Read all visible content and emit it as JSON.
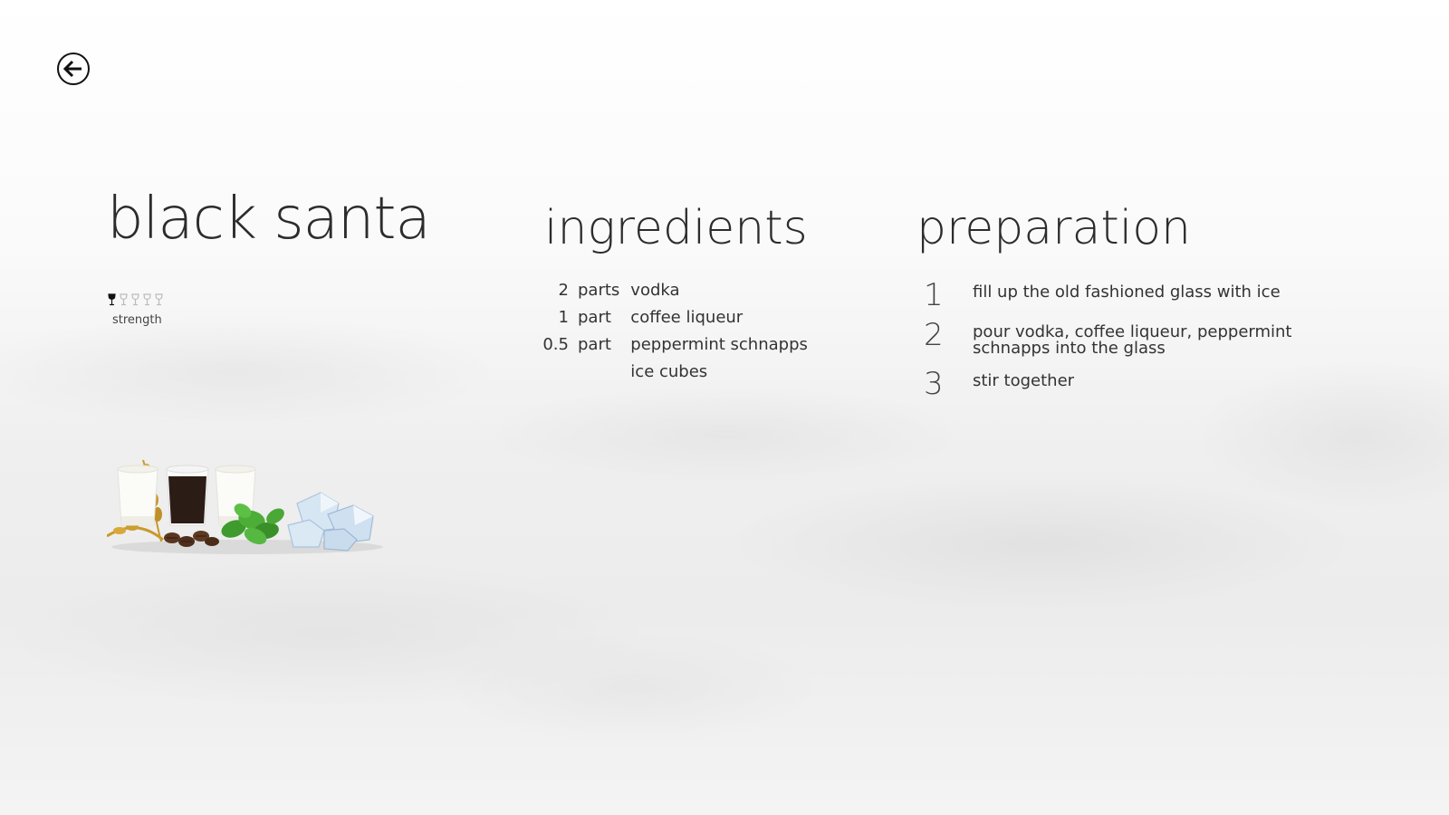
{
  "header": {
    "back_icon": "arrow-left-circle-icon"
  },
  "drink": {
    "name": "black santa",
    "strength": {
      "label": "strength",
      "level": 1,
      "max": 5
    },
    "image_alt": "ingredient cups with wheat, coffee beans, mint and ice"
  },
  "ingredients": {
    "heading": "ingredients",
    "items": [
      {
        "amount": "2",
        "unit": "parts",
        "name": "vodka"
      },
      {
        "amount": "1",
        "unit": "part",
        "name": "coffee liqueur"
      },
      {
        "amount": "0.5",
        "unit": "part",
        "name": "peppermint schnapps"
      },
      {
        "amount": "",
        "unit": "",
        "name": "ice cubes"
      }
    ]
  },
  "preparation": {
    "heading": "preparation",
    "steps": [
      {
        "number": "1",
        "text": "fill up the old fashioned glass with ice"
      },
      {
        "number": "2",
        "text": "pour vodka, coffee liqueur, peppermint schnapps into the glass"
      },
      {
        "number": "3",
        "text": "stir together"
      }
    ]
  },
  "colors": {
    "text": "#333333",
    "heading": "#2c2c2c",
    "strength_active": "#111111",
    "strength_inactive": "#bbbbbb"
  }
}
